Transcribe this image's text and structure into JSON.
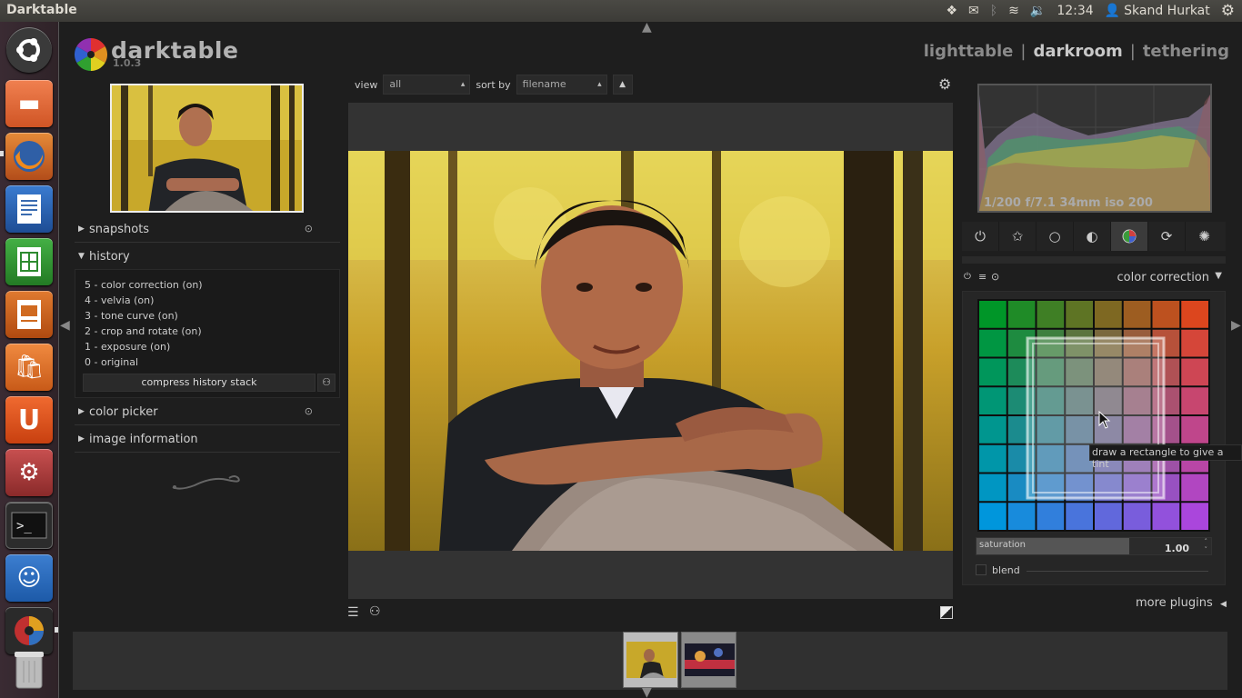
{
  "top_panel": {
    "window_title": "Darktable",
    "time": "12:34",
    "user": "Skand Hurkat",
    "icons": [
      "dropbox-icon",
      "mail-icon",
      "bluetooth-icon",
      "wifi-icon",
      "volume-icon",
      "user-icon",
      "power-gear-icon"
    ]
  },
  "launcher": {
    "items": [
      "dash-home-icon",
      "files-icon",
      "firefox-icon",
      "writer-icon",
      "calc-icon",
      "impress-icon",
      "software-center-icon",
      "ubuntu-one-icon",
      "system-settings-icon",
      "terminal-icon",
      "empathy-icon",
      "darktable-icon",
      "trash-icon"
    ]
  },
  "app": {
    "name": "darktable",
    "version": "1.0.3",
    "views": [
      "lighttable",
      "darkroom",
      "tethering"
    ],
    "active_view": "darkroom",
    "separator": "|"
  },
  "left_panel": {
    "modules": {
      "snapshots": "snapshots",
      "history": "history",
      "color_picker": "color picker",
      "image_information": "image information"
    },
    "history_items": [
      "5 - color correction (on)",
      "4 - velvia (on)",
      "3 - tone curve (on)",
      "2 - crop and rotate (on)",
      "1 - exposure (on)",
      "0 - original"
    ],
    "compress_label": "compress history stack"
  },
  "filter": {
    "view_label": "view",
    "view_value": "all",
    "sort_label": "sort by",
    "sort_value": "filename"
  },
  "right_panel": {
    "exif_info": "1/200 f/7.1 34mm iso 200",
    "module_title": "color correction",
    "tooltip": "draw a rectangle to give a tint",
    "saturation_label": "saturation",
    "saturation_value": "1.00",
    "saturation_fraction": 0.65,
    "blend_label": "blend",
    "more_plugins": "more plugins"
  },
  "colors": {
    "background": "#1e1e1e",
    "panel": "#262626",
    "text": "#cccccc"
  }
}
